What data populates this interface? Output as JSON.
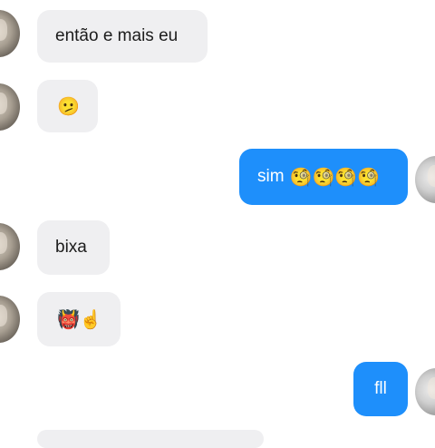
{
  "messages": [
    {
      "side": "in",
      "text": "então e mais eu"
    },
    {
      "side": "in",
      "text": "🫤"
    },
    {
      "side": "out",
      "text": "sim",
      "emoji": "🧐🧐🧐🧐"
    },
    {
      "side": "in",
      "text": "bixa"
    },
    {
      "side": "in",
      "text": "👹☝️"
    },
    {
      "side": "out",
      "text": "fll"
    }
  ],
  "colors": {
    "incoming_bubble": "#efeff1",
    "outgoing_bubble": "#1e8ffb",
    "incoming_text": "#1c1c1c",
    "outgoing_text": "#ffffff"
  }
}
